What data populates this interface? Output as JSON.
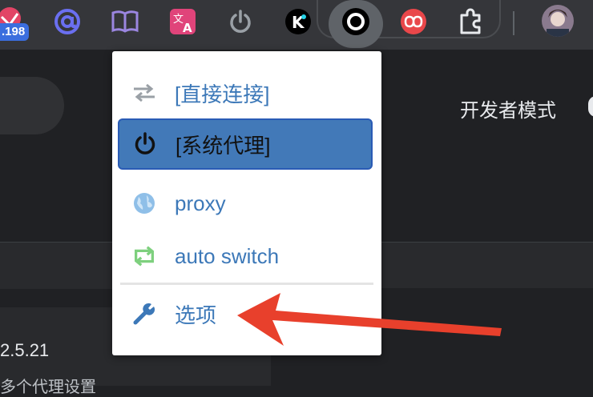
{
  "toolbar": {
    "badge_text": ".198",
    "extensions": [
      {
        "name": "stats-ext-icon"
      },
      {
        "name": "at-sign-icon"
      },
      {
        "name": "book-icon"
      },
      {
        "name": "translate-icon"
      },
      {
        "name": "power-icon"
      },
      {
        "name": "k-icon"
      },
      {
        "name": "circle-icon"
      },
      {
        "name": "infinity-icon"
      },
      {
        "name": "puzzle-icon"
      },
      {
        "name": "avatar"
      }
    ]
  },
  "page": {
    "dev_mode_label": "开发者模式",
    "version": "2.5.21",
    "description": "多个代理设置"
  },
  "popup": {
    "items": [
      {
        "label": "[直接连接]",
        "icon": "swap-arrows-icon"
      },
      {
        "label": "[系统代理]",
        "icon": "power-icon",
        "selected": true
      },
      {
        "label": "proxy",
        "icon": "globe-icon"
      },
      {
        "label": "auto switch",
        "icon": "retweet-icon"
      },
      {
        "label": "选项",
        "icon": "wrench-icon"
      }
    ]
  },
  "colors": {
    "menu_text": "#3c78b8",
    "selected_bg": "#4279b8",
    "arrow": "#e8402c",
    "toolbar_bg": "#35363a",
    "page_bg": "#202124"
  }
}
